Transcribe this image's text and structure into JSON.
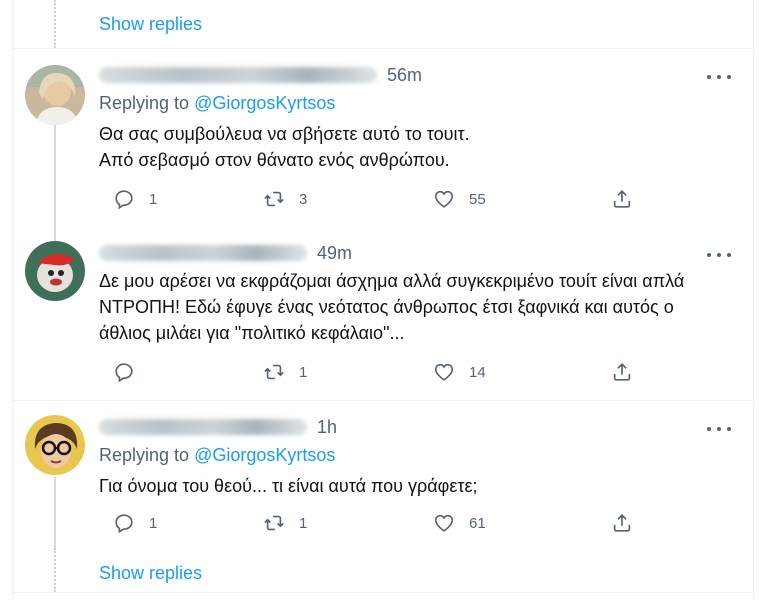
{
  "top_show_replies": "Show replies",
  "bottom_show_replies": "Show replies",
  "tweets": [
    {
      "time": "56m",
      "replying_prefix": "Replying to",
      "replying_to": "@GiorgosKyrtsos",
      "lines": [
        "Θα σας συμβούλευα να σβήσετε αυτό το τουιτ.",
        "Από σεβασμό στον θάνατο ενός ανθρώπου."
      ],
      "reply_count": "1",
      "retweet_count": "3",
      "like_count": "55"
    },
    {
      "time": "49m",
      "lines": [
        "Δε μου αρέσει να εκφράζομαι άσχημα αλλά συγκεκριμένο τουίτ είναι απλά",
        "ΝΤΡΟΠΗ! Εδώ έφυγε ένας νεότατος άνθρωπος έτσι ξαφνικά και αυτός ο",
        "άθλιος μιλάει για \"πολιτικό κεφάλαιο\"..."
      ],
      "reply_count": "",
      "retweet_count": "1",
      "like_count": "14"
    },
    {
      "time": "1h",
      "replying_prefix": "Replying to",
      "replying_to": "@GiorgosKyrtsos",
      "lines": [
        "Για όνομα του θεού... τι είναι αυτά που γράφετε;"
      ],
      "reply_count": "1",
      "retweet_count": "1",
      "like_count": "61"
    }
  ],
  "colors": {
    "link": "#1d9bf0",
    "secondary_text": "#536471",
    "primary_text": "#0f1419",
    "divider": "#eff3f4"
  },
  "icons": {
    "reply": "reply-icon",
    "retweet": "retweet-icon",
    "like": "like-icon",
    "share": "share-icon",
    "more": "more-icon"
  }
}
